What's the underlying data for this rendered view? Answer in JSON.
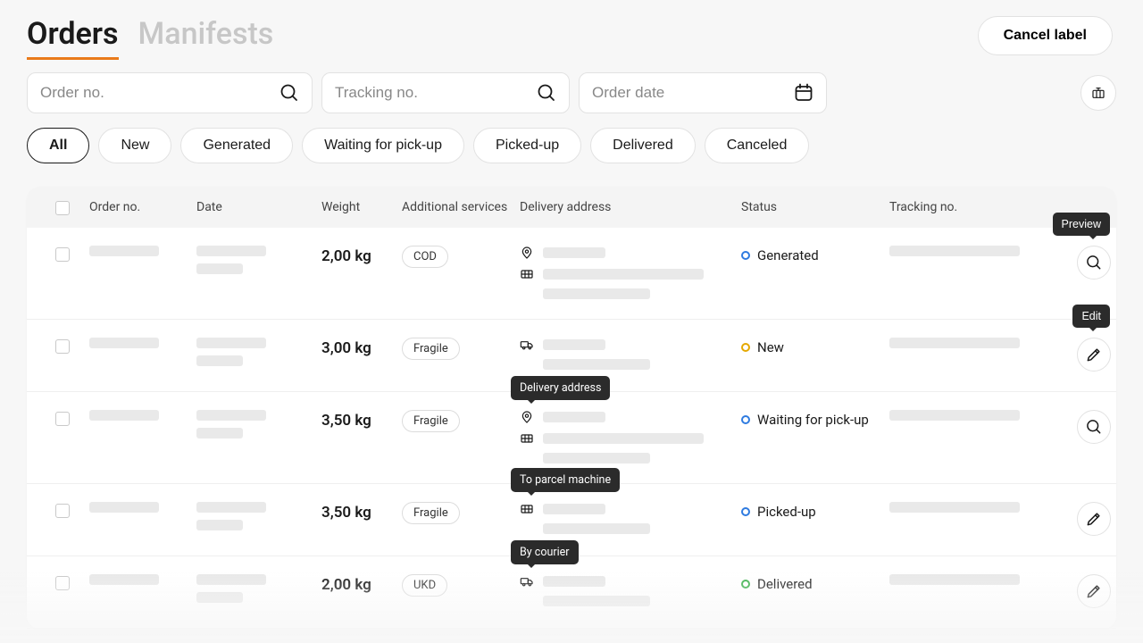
{
  "tabs": {
    "orders": "Orders",
    "manifests": "Manifests"
  },
  "buttons": {
    "cancel_label": "Cancel label"
  },
  "search": {
    "order_placeholder": "Order no.",
    "tracking_placeholder": "Tracking no.",
    "date_placeholder": "Order date"
  },
  "filters": [
    "All",
    "New",
    "Generated",
    "Waiting for pick-up",
    "Picked-up",
    "Delivered",
    "Canceled"
  ],
  "columns": {
    "order_no": "Order no.",
    "date": "Date",
    "weight": "Weight",
    "services": "Additional services",
    "address": "Delivery address",
    "status": "Status",
    "tracking": "Tracking no."
  },
  "tooltips": {
    "preview": "Preview",
    "edit": "Edit",
    "delivery_address": "Delivery address",
    "to_parcel_machine": "To parcel machine",
    "by_courier": "By courier"
  },
  "rows": [
    {
      "weight": "2,00 kg",
      "service": "COD",
      "addr_icons": [
        "pin",
        "grid"
      ],
      "status_label": "Generated",
      "status_color": "blue",
      "action": "preview"
    },
    {
      "weight": "3,00 kg",
      "service": "Fragile",
      "addr_icons": [
        "truck"
      ],
      "status_label": "New",
      "status_color": "amber",
      "action": "edit"
    },
    {
      "weight": "3,50 kg",
      "service": "Fragile",
      "addr_icons": [
        "pin",
        "grid"
      ],
      "status_label": "Waiting for pick-up",
      "status_color": "blue",
      "action": "preview"
    },
    {
      "weight": "3,50 kg",
      "service": "Fragile",
      "addr_icons": [
        "grid"
      ],
      "status_label": "Picked-up",
      "status_color": "blue",
      "action": "edit"
    },
    {
      "weight": "2,00 kg",
      "service": "UKD",
      "addr_icons": [
        "truck"
      ],
      "status_label": "Delivered",
      "status_color": "green",
      "action": "edit"
    }
  ]
}
